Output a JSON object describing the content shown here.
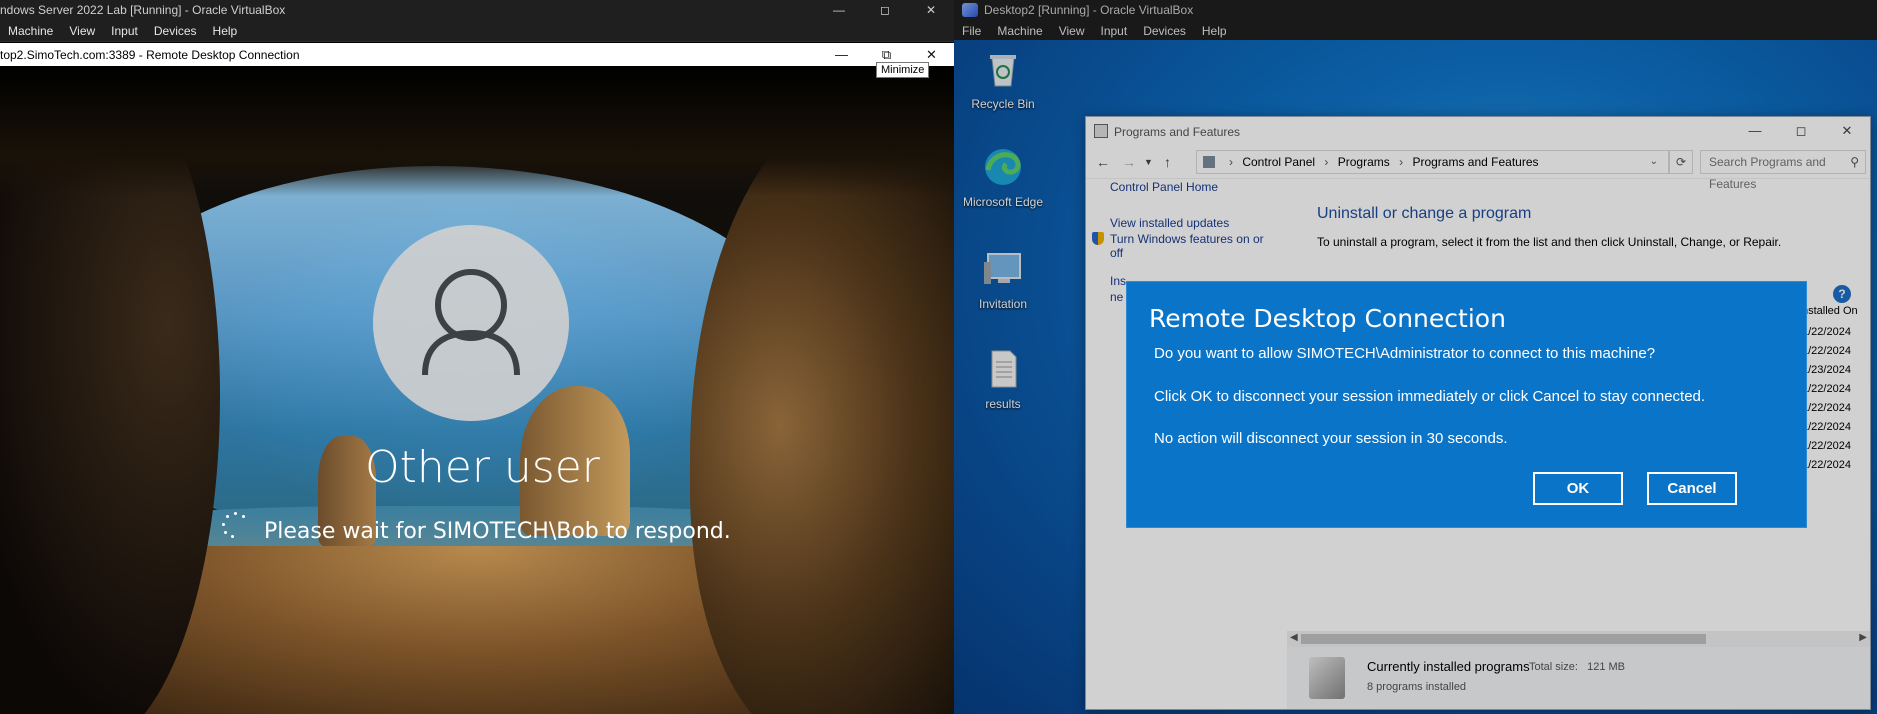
{
  "left_vm": {
    "window_title": "ndows Server 2022 Lab [Running] - Oracle VirtualBox",
    "menu": [
      "Machine",
      "View",
      "Input",
      "Devices",
      "Help"
    ],
    "rdp_title": "top2.SimoTech.com:3389 - Remote Desktop Connection",
    "tooltip": "Minimize",
    "lock_screen": {
      "user_name": "Other user",
      "status": "Please wait for SIMOTECH\\Bob to respond."
    }
  },
  "right_vm": {
    "window_title": "Desktop2 [Running] - Oracle VirtualBox",
    "menu": [
      "File",
      "Machine",
      "View",
      "Input",
      "Devices",
      "Help"
    ],
    "desktop_icons": [
      {
        "label": "Recycle Bin",
        "icon": "recycle-bin-icon"
      },
      {
        "label": "Microsoft Edge",
        "icon": "edge-icon"
      },
      {
        "label": "Invitation",
        "icon": "computer-icon"
      },
      {
        "label": "results",
        "icon": "document-icon"
      }
    ],
    "programs_window": {
      "title": "Programs and Features",
      "breadcrumb": [
        "Control Panel",
        "Programs",
        "Programs and Features"
      ],
      "search_placeholder": "Search Programs and Features",
      "sidebar": [
        "Control Panel Home",
        "View installed updates",
        "Turn Windows features on or off",
        "Ins",
        "ne"
      ],
      "main_title": "Uninstall or change a program",
      "main_desc": "To uninstall a program, select it from the list and then click Uninstall, Change, or Repair.",
      "column_header": "nstalled On",
      "install_dates": [
        "1/22/2024",
        "1/22/2024",
        "1/23/2024",
        "1/22/2024",
        "1/22/2024",
        "1/22/2024",
        "1/22/2024",
        "1/22/2024"
      ],
      "footer": {
        "title": "Currently installed programs",
        "total_size_label": "Total size:",
        "total_size": "121 MB",
        "count": "8 programs installed"
      }
    },
    "dialog": {
      "title": "Remote Desktop Connection",
      "line1": "Do you want to allow SIMOTECH\\Administrator to connect to this machine?",
      "line2": "Click OK to disconnect your session immediately or click Cancel to stay connected.",
      "line3": "No action will disconnect your session in 30 seconds.",
      "ok_label": "OK",
      "cancel_label": "Cancel"
    }
  }
}
